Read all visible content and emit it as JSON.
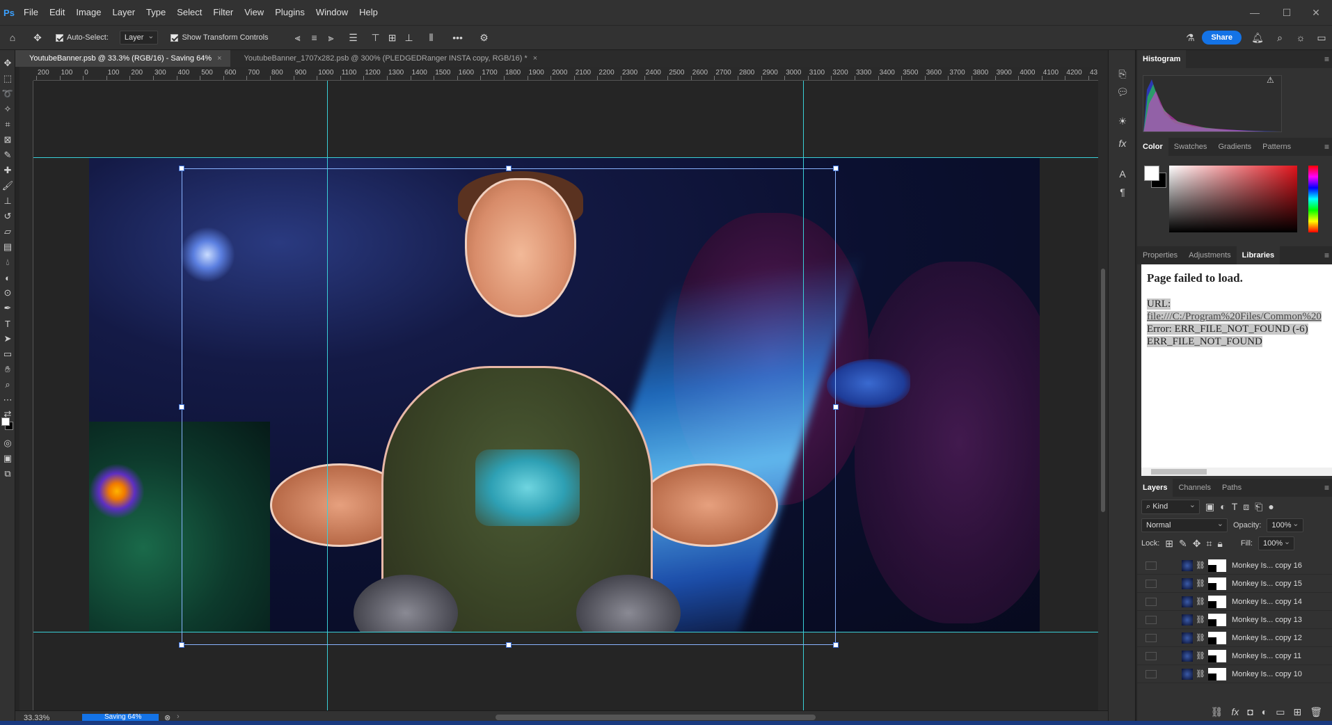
{
  "app": {
    "logo": "Ps"
  },
  "menu": [
    "File",
    "Edit",
    "Image",
    "Layer",
    "Type",
    "Select",
    "Filter",
    "View",
    "Plugins",
    "Window",
    "Help"
  ],
  "window_controls": {
    "minimize": "—",
    "maximize": "☐",
    "close": "✕"
  },
  "options_bar": {
    "auto_select_label": "Auto-Select:",
    "auto_select_checked": true,
    "auto_select_target": "Layer",
    "show_transform_label": "Show Transform Controls",
    "show_transform_checked": true,
    "more_label": "•••",
    "share_label": "Share"
  },
  "tabs": [
    {
      "label": "YoutubeBanner.psb @ 33.3% (RGB/16) - Saving 64%",
      "close": "×",
      "active": true
    },
    {
      "label": "YoutubeBanner_1707x282.psb @ 300% (PLEDGEDRanger INSTA copy, RGB/16) *",
      "close": "×",
      "active": false
    }
  ],
  "ruler": {
    "labels": [
      "200",
      "100",
      "0",
      "100",
      "200",
      "300",
      "400",
      "500",
      "600",
      "700",
      "800",
      "900",
      "1000",
      "1100",
      "1200",
      "1300",
      "1400",
      "1500",
      "1600",
      "1700",
      "1800",
      "1900",
      "2000",
      "2100",
      "2200",
      "2300",
      "2400",
      "2500",
      "2600",
      "2700",
      "2800",
      "2900",
      "3000",
      "3100",
      "3200",
      "3300",
      "3400",
      "3500",
      "3600",
      "3700",
      "3800",
      "3900",
      "4000",
      "4100",
      "4200",
      "43"
    ]
  },
  "status": {
    "zoom": "33.33%",
    "saving": "Saving 64%",
    "saving_progress": 0.64
  },
  "panels": {
    "histogram_tab": "Histogram",
    "histogram_warning": "⚠",
    "color_tabs": [
      "Color",
      "Swatches",
      "Gradients",
      "Patterns"
    ],
    "color_fg": "#ffffff",
    "color_bg": "#000000",
    "properties_tabs": [
      "Properties",
      "Adjustments",
      "Libraries"
    ],
    "library": {
      "title": "Page failed to load.",
      "url_label": "URL:",
      "url": "file:///C:/Program%20Files/Common%20",
      "error": "Error: ERR_FILE_NOT_FOUND (-6)",
      "error_code": "ERR_FILE_NOT_FOUND"
    },
    "layers_tabs": [
      "Layers",
      "Channels",
      "Paths"
    ],
    "filter_kind": "Kind",
    "blend_mode": "Normal",
    "opacity_label": "Opacity:",
    "opacity_value": "100%",
    "lock_label": "Lock:",
    "fill_label": "Fill:",
    "fill_value": "100%",
    "layers": [
      "Monkey Is... copy 16",
      "Monkey Is... copy 15",
      "Monkey Is... copy 14",
      "Monkey Is... copy 13",
      "Monkey Is... copy 12",
      "Monkey Is... copy 11",
      "Monkey Is... copy 10"
    ]
  },
  "colors": {
    "accent": "#1473e6",
    "guide": "#3ad0d8",
    "transform": "#8ab4ff"
  }
}
